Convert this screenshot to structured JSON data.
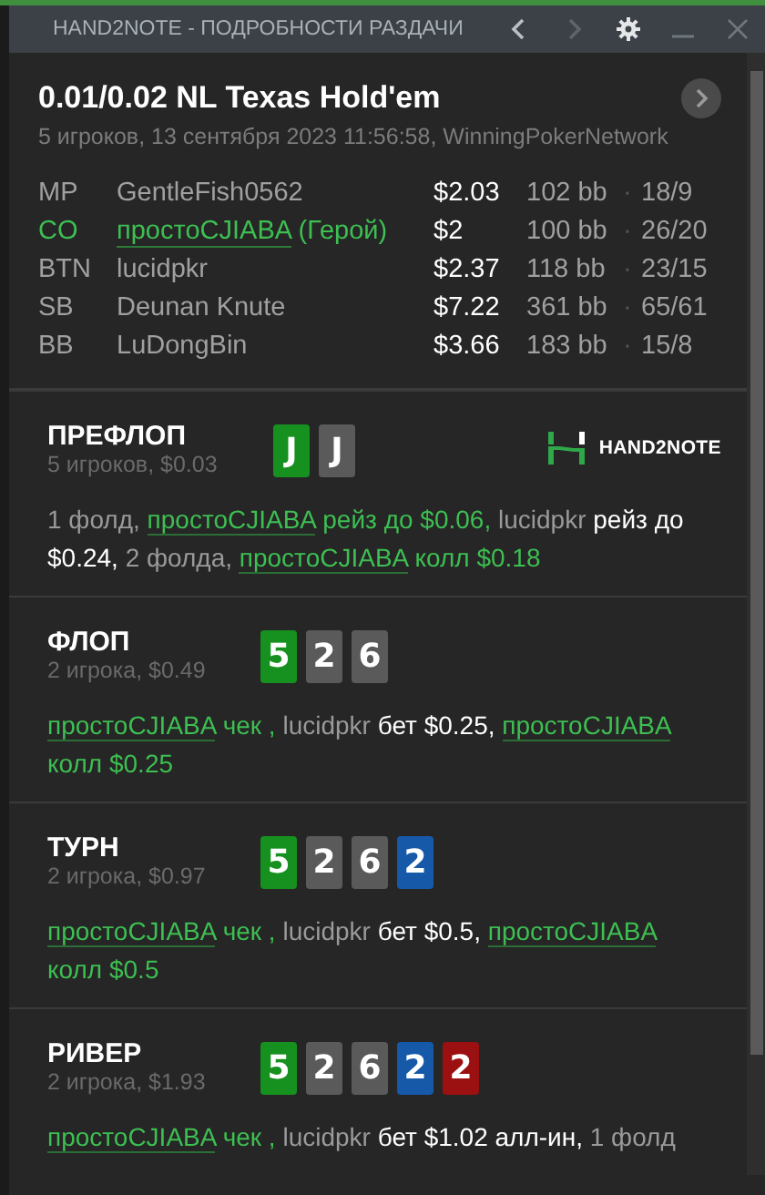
{
  "window": {
    "title": "HAND2NOTE - ПОДРОБНОСТИ РАЗДАЧИ"
  },
  "header": {
    "title": "0.01/0.02 NL Texas Hold'em",
    "subtitle": "5 игроков, 13 сентября 2023 11:56:58, WinningPokerNetwork"
  },
  "players": [
    {
      "position": "MP",
      "name": "GentleFish0562",
      "hero": false,
      "stack": "$2.03",
      "bb": "102 bb",
      "separator": "·",
      "hands": "18/9"
    },
    {
      "position": "CO",
      "name": "простоCJIABA",
      "hero_label": "(Герой)",
      "hero": true,
      "stack": "$2",
      "bb": "100 bb",
      "separator": "·",
      "hands": "26/20"
    },
    {
      "position": "BTN",
      "name": "lucidpkr",
      "hero": false,
      "stack": "$2.37",
      "bb": "118 bb",
      "separator": "·",
      "hands": "23/15"
    },
    {
      "position": "SB",
      "name": "Deunan Knute",
      "hero": false,
      "stack": "$7.22",
      "bb": "361 bb",
      "separator": "·",
      "hands": "65/61"
    },
    {
      "position": "BB",
      "name": "LuDongBin",
      "hero": false,
      "stack": "$3.66",
      "bb": "183 bb",
      "separator": "·",
      "hands": "15/8"
    }
  ],
  "logo": {
    "text": "HAND2NOTE"
  },
  "streets": [
    {
      "name": "ПРЕФЛОП",
      "info": "5 игроков, $0.03",
      "cards": [
        {
          "rank": "J",
          "color": "#16901e"
        },
        {
          "rank": "J",
          "color": "#5a5a5a"
        }
      ],
      "actions": [
        {
          "kind": "muted",
          "text": "1 фолд, "
        },
        {
          "kind": "hero-name",
          "text": "простоCJIABA"
        },
        {
          "kind": "hero",
          "text": " рейз до $0.06, "
        },
        {
          "kind": "muted",
          "text": "lucidpkr"
        },
        {
          "kind": "bright",
          "text": " рейз до $0.24, "
        },
        {
          "kind": "muted",
          "text": "2 фолда, "
        },
        {
          "kind": "hero-name",
          "text": "простоCJIABA"
        },
        {
          "kind": "hero",
          "text": " колл $0.18"
        }
      ]
    },
    {
      "name": "ФЛОП",
      "info": "2 игрока, $0.49",
      "cards": [
        {
          "rank": "5",
          "color": "#16901e"
        },
        {
          "rank": "2",
          "color": "#5a5a5a"
        },
        {
          "rank": "6",
          "color": "#5a5a5a"
        }
      ],
      "actions": [
        {
          "kind": "hero-name",
          "text": "простоCJIABA"
        },
        {
          "kind": "hero",
          "text": " чек , "
        },
        {
          "kind": "muted",
          "text": "lucidpkr"
        },
        {
          "kind": "bright",
          "text": " бет $0.25, "
        },
        {
          "kind": "hero-name",
          "text": "простоCJIABA"
        },
        {
          "kind": "hero",
          "text": " колл $0.25"
        }
      ]
    },
    {
      "name": "ТУРН",
      "info": "2 игрока, $0.97",
      "cards": [
        {
          "rank": "5",
          "color": "#16901e"
        },
        {
          "rank": "2",
          "color": "#5a5a5a"
        },
        {
          "rank": "6",
          "color": "#5a5a5a"
        },
        {
          "rank": "2",
          "color": "#1559a8"
        }
      ],
      "actions": [
        {
          "kind": "hero-name",
          "text": "простоCJIABA"
        },
        {
          "kind": "hero",
          "text": " чек , "
        },
        {
          "kind": "muted",
          "text": "lucidpkr"
        },
        {
          "kind": "bright",
          "text": " бет $0.5, "
        },
        {
          "kind": "hero-name",
          "text": "простоCJIABA"
        },
        {
          "kind": "hero",
          "text": " колл $0.5"
        }
      ]
    },
    {
      "name": "РИВЕР",
      "info": "2 игрока, $1.93",
      "cards": [
        {
          "rank": "5",
          "color": "#16901e"
        },
        {
          "rank": "2",
          "color": "#5a5a5a"
        },
        {
          "rank": "6",
          "color": "#5a5a5a"
        },
        {
          "rank": "2",
          "color": "#1559a8"
        },
        {
          "rank": "2",
          "color": "#9b1111"
        }
      ],
      "actions": [
        {
          "kind": "hero-name",
          "text": "простоCJIABA"
        },
        {
          "kind": "hero",
          "text": " чек , "
        },
        {
          "kind": "muted",
          "text": "lucidpkr"
        },
        {
          "kind": "bright",
          "text": " бет $1.02 алл-ин, "
        },
        {
          "kind": "muted",
          "text": "1 фолд"
        }
      ]
    }
  ]
}
